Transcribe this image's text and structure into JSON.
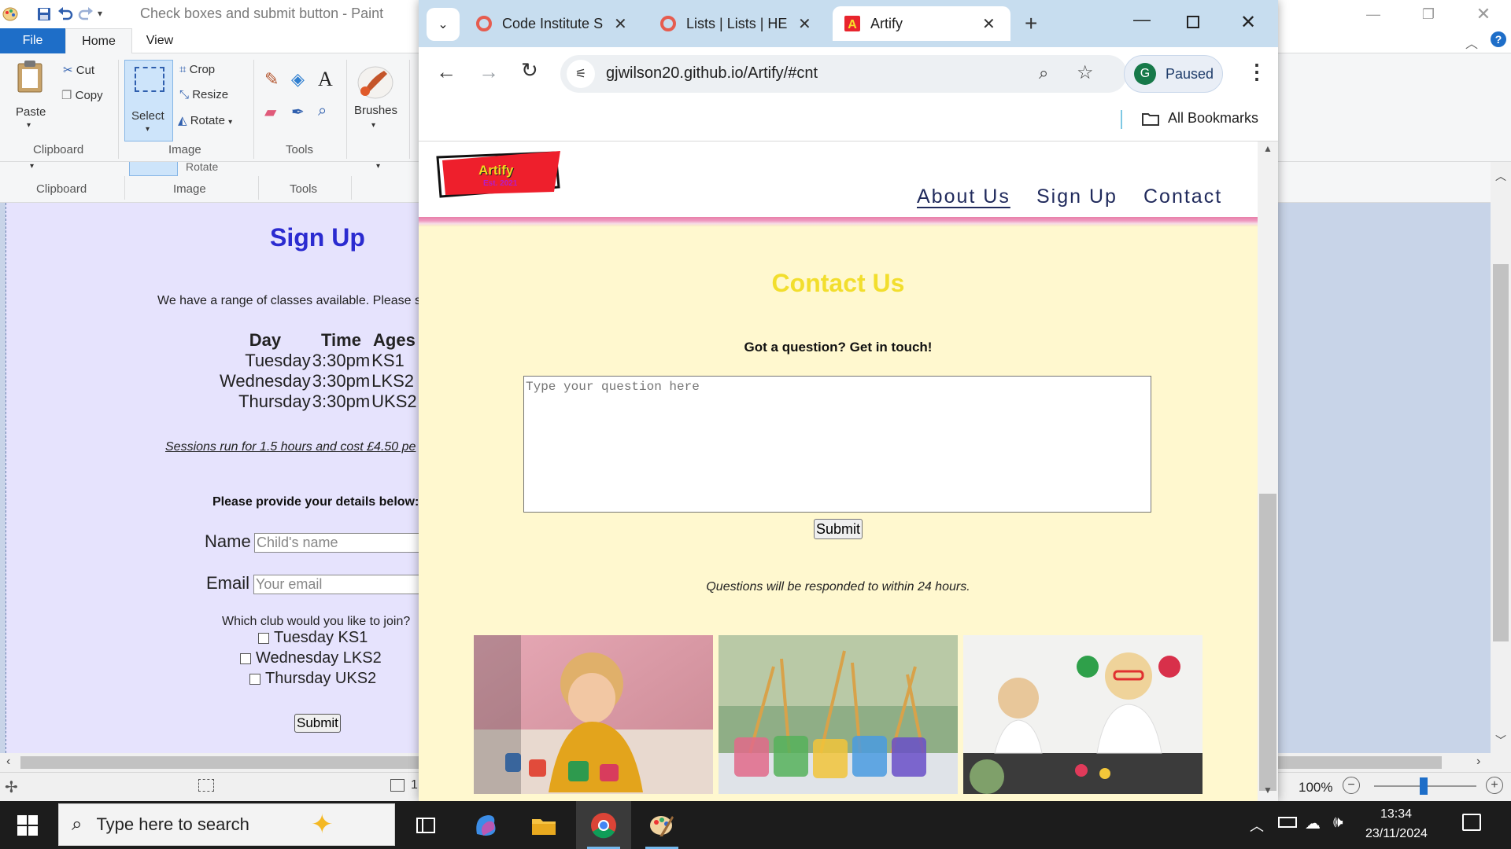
{
  "paint": {
    "title": "Check boxes and submit button - Paint",
    "tabs": {
      "file": "File",
      "home": "Home",
      "view": "View"
    },
    "clipboard": {
      "paste": "Paste",
      "cut": "Cut",
      "copy": "Copy",
      "group": "Clipboard"
    },
    "image": {
      "select": "Select",
      "crop": "Crop",
      "resize": "Resize",
      "rotate": "Rotate",
      "group": "Image"
    },
    "tools": {
      "group": "Tools"
    },
    "brushes": {
      "label": "Brushes"
    },
    "ghost_ribbon": {
      "clipboard": "Clipboard",
      "image": "Image",
      "tools": "Tools",
      "rotate": "Rotate"
    },
    "zoom": "100%",
    "status_size": "1"
  },
  "canvas_image": {
    "title": "Sign Up",
    "intro": "We have a range of classes available. Please s",
    "table": {
      "headers": [
        "Day",
        "Time",
        "Ages"
      ],
      "rows": [
        [
          "Tuesday",
          "3:30pm",
          "KS1"
        ],
        [
          "Wednesday",
          "3:30pm",
          "LKS2"
        ],
        [
          "Thursday",
          "3:30pm",
          "UKS2"
        ]
      ]
    },
    "sessions": "Sessions run for 1.5 hours and cost £4.50 pe",
    "details": "Please provide your details below:",
    "name_label": "Name",
    "name_placeholder": "Child's name",
    "email_label": "Email",
    "email_placeholder": "Your email",
    "club_question": "Which club would you like to join?",
    "clubs": [
      "Tuesday KS1",
      "Wednesday LKS2",
      "Thursday UKS2"
    ],
    "submit": "Submit"
  },
  "chrome": {
    "tabs": [
      {
        "title": "Code Institute S",
        "favicon": "code-institute-icon",
        "active": false
      },
      {
        "title": "Lists | Lists | HE",
        "favicon": "code-institute-icon",
        "active": false
      },
      {
        "title": "Artify",
        "favicon": "artify-icon",
        "active": true
      }
    ],
    "url": "gjwilson20.github.io/Artify/#cnt",
    "profile": {
      "initial": "G",
      "status": "Paused"
    },
    "bookmarks": "All Bookmarks"
  },
  "site": {
    "logo": {
      "name": "Artify",
      "tagline": "Est. 2021"
    },
    "nav": [
      "About Us",
      "Sign Up",
      "Contact"
    ],
    "contact_title": "Contact Us",
    "contact_sub": "Got a question? Get in touch!",
    "question_placeholder": "Type your question here",
    "submit": "Submit",
    "response_note": "Questions will be responded to within 24 hours."
  },
  "taskbar": {
    "search_placeholder": "Type here to search",
    "time": "13:34",
    "date": "23/11/2024"
  },
  "colors": {
    "site_background": "#fff8cf",
    "contact_title": "#f2de2d",
    "nav_text": "#202a5c",
    "paint_file_tab": "#1e6ec8",
    "canvas_background": "#e6e3fd",
    "canvas_title": "#2b2bd0"
  }
}
